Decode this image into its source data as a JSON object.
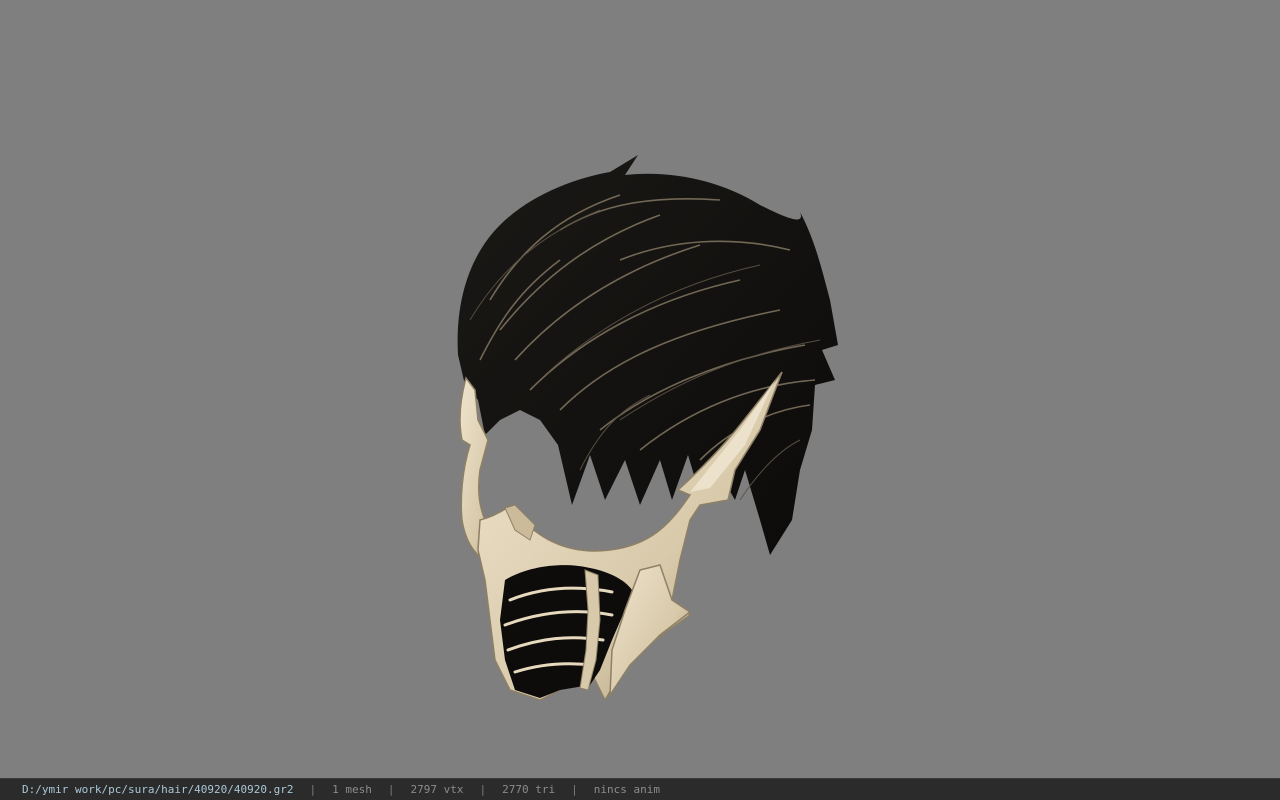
{
  "viewport": {
    "background": "#7f7f7f",
    "model": {
      "subject": "hair-with-mask-icon",
      "hair_color": "#141210",
      "hair_highlight": "#8a7d66",
      "mask_color": "#e8dcc2",
      "mask_shadow": "#9c8e72"
    }
  },
  "statusbar": {
    "file_path": "D:/ymir work/pc/sura/hair/40920/40920.gr2",
    "separator": "|",
    "mesh": "1 mesh",
    "vtx": "2797 vtx",
    "tri": "2770 tri",
    "anim": "nincs anim"
  }
}
